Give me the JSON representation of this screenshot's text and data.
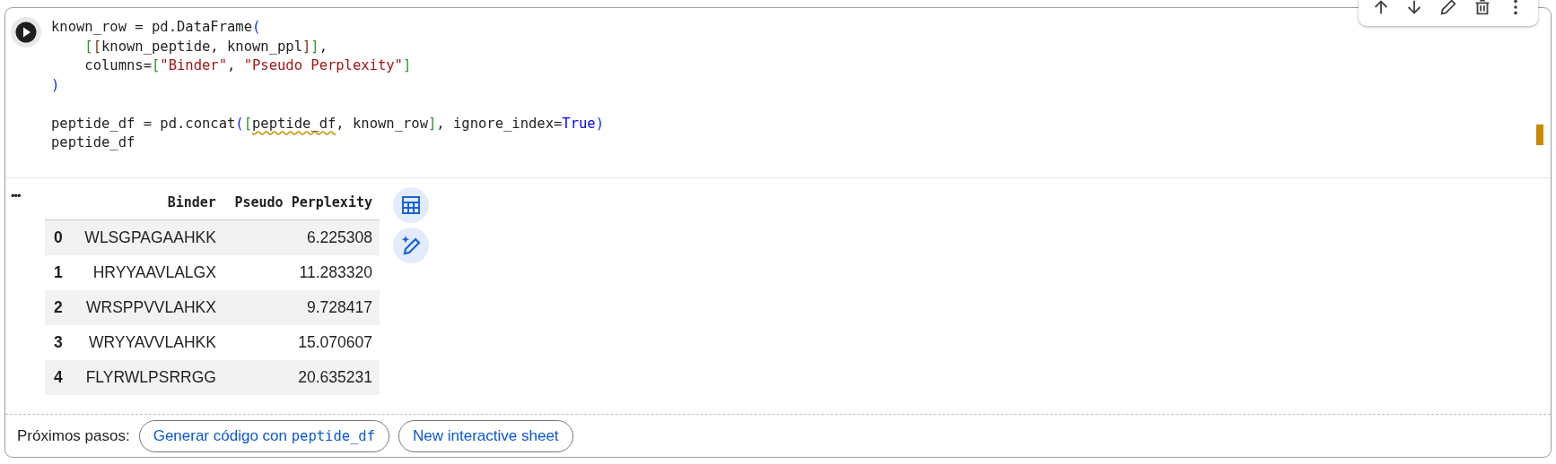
{
  "cell_toolbar": {
    "buttons": [
      {
        "kind": "up"
      },
      {
        "kind": "down"
      },
      {
        "kind": "edit"
      },
      {
        "kind": "delete"
      },
      {
        "kind": "more"
      }
    ]
  },
  "code": {
    "lines": [
      {
        "tokens": [
          {
            "kind": "plain",
            "text": "known_row = pd.DataFrame"
          },
          {
            "kind": "paren",
            "text": "("
          }
        ]
      },
      {
        "indent": true,
        "tokens": [
          {
            "kind": "bracket",
            "text": "["
          },
          {
            "kind": "bracket2",
            "text": "["
          },
          {
            "kind": "plain",
            "text": "known_peptide, known_ppl"
          },
          {
            "kind": "bracket2",
            "text": "]"
          },
          {
            "kind": "bracket",
            "text": "]"
          },
          {
            "kind": "plain",
            "text": ","
          }
        ]
      },
      {
        "indent": true,
        "tokens": [
          {
            "kind": "plain",
            "text": "columns="
          },
          {
            "kind": "bracket",
            "text": "["
          },
          {
            "kind": "string",
            "text": "\"Binder\""
          },
          {
            "kind": "plain",
            "text": ", "
          },
          {
            "kind": "string",
            "text": "\"Pseudo Perplexity\""
          },
          {
            "kind": "bracket",
            "text": "]"
          }
        ]
      },
      {
        "tokens": [
          {
            "kind": "paren",
            "text": ")"
          }
        ]
      },
      {
        "kind": "blank"
      },
      {
        "tokens": [
          {
            "kind": "plain",
            "text": "peptide_df = pd.concat"
          },
          {
            "kind": "paren",
            "text": "("
          },
          {
            "kind": "bracket",
            "text": "["
          },
          {
            "kind": "warned",
            "text": "peptide_df"
          },
          {
            "kind": "plain",
            "text": ", known_row"
          },
          {
            "kind": "bracket",
            "text": "]"
          },
          {
            "kind": "plain",
            "text": ", ignore_index="
          },
          {
            "kind": "keyword",
            "text": "True"
          },
          {
            "kind": "paren",
            "text": ")"
          }
        ]
      },
      {
        "tokens": [
          {
            "kind": "plain",
            "text": "peptide_df"
          }
        ]
      }
    ]
  },
  "output": {
    "menu": "•••",
    "table": {
      "columns": [
        "Binder",
        "Pseudo Perplexity"
      ],
      "rows": [
        {
          "index": "0",
          "cells": [
            "WLSGPAGAAHKK",
            "6.225308"
          ]
        },
        {
          "index": "1",
          "cells": [
            "HRYYAAVLALGX",
            "11.283320"
          ]
        },
        {
          "index": "2",
          "cells": [
            "WRSPPVVLAHKX",
            "9.728417"
          ]
        },
        {
          "index": "3",
          "cells": [
            "WRYYAVVLAHKK",
            "15.070607"
          ]
        },
        {
          "index": "4",
          "cells": [
            "FLYRWLPSRRGG",
            "20.635231"
          ]
        }
      ]
    },
    "actions": [
      {
        "kind": "table"
      },
      {
        "kind": "magic"
      }
    ]
  },
  "next_steps": {
    "label": "Próximos pasos:",
    "buttons": [
      {
        "label": "Generar código con ",
        "code": "peptide_df"
      },
      {
        "label": "New interactive sheet"
      }
    ]
  }
}
